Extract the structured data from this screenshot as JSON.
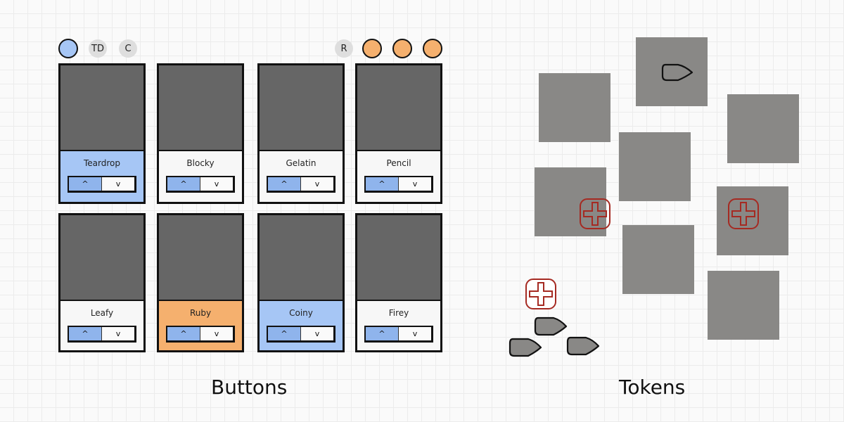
{
  "buttons_section": {
    "label": "Buttons",
    "left_indicators": [
      {
        "type": "player-circle",
        "color": "#a6c6f5"
      },
      {
        "type": "tag",
        "text": "TD"
      },
      {
        "type": "tag",
        "text": "C"
      }
    ],
    "right_indicators": [
      {
        "type": "tag",
        "text": "R"
      },
      {
        "type": "player-circle",
        "color": "#f5b06e"
      },
      {
        "type": "player-circle",
        "color": "#f5b06e"
      },
      {
        "type": "player-circle",
        "color": "#f5b06e"
      }
    ],
    "cards": [
      {
        "name": "Teardrop",
        "state": "blue",
        "up_label": "^",
        "down_label": "v"
      },
      {
        "name": "Blocky",
        "state": "none",
        "up_label": "^",
        "down_label": "v"
      },
      {
        "name": "Gelatin",
        "state": "none",
        "up_label": "^",
        "down_label": "v"
      },
      {
        "name": "Pencil",
        "state": "none",
        "up_label": "^",
        "down_label": "v"
      },
      {
        "name": "Leafy",
        "state": "none",
        "up_label": "^",
        "down_label": "v"
      },
      {
        "name": "Ruby",
        "state": "orange",
        "up_label": "^",
        "down_label": "v"
      },
      {
        "name": "Coiny",
        "state": "blue",
        "up_label": "^",
        "down_label": "v"
      },
      {
        "name": "Firey",
        "state": "none",
        "up_label": "^",
        "down_label": "v"
      }
    ]
  },
  "tokens_section": {
    "label": "Tokens",
    "tile_count": 8,
    "tokens": [
      {
        "type": "bullet-outline",
        "on_tile": true
      },
      {
        "type": "medkit",
        "on_tile": true
      },
      {
        "type": "medkit",
        "on_tile": true
      },
      {
        "type": "medkit",
        "on_tile": false
      },
      {
        "type": "bullet",
        "on_tile": false
      },
      {
        "type": "bullet",
        "on_tile": false
      },
      {
        "type": "bullet",
        "on_tile": false
      }
    ]
  },
  "colors": {
    "blue": "#a6c6f5",
    "orange": "#f5b06e",
    "card_art": "#666666",
    "tile": "#898886",
    "medkit": "#a52a22",
    "button_up": "#8fb4ec"
  }
}
